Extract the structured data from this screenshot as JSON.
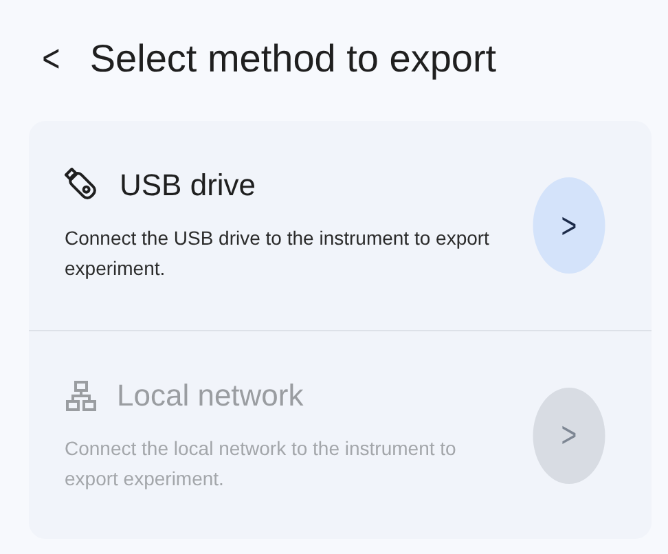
{
  "header": {
    "back": "<",
    "title": "Select method to export"
  },
  "options": [
    {
      "kind": "usb",
      "title": "USB drive",
      "description": "Connect the USB drive to the instrument to export experiment.",
      "arrow": ">",
      "disabled": false
    },
    {
      "kind": "network",
      "title": "Local network",
      "description": "Connect the local network to the instrument to export experiment.",
      "arrow": ">",
      "disabled": true
    }
  ]
}
